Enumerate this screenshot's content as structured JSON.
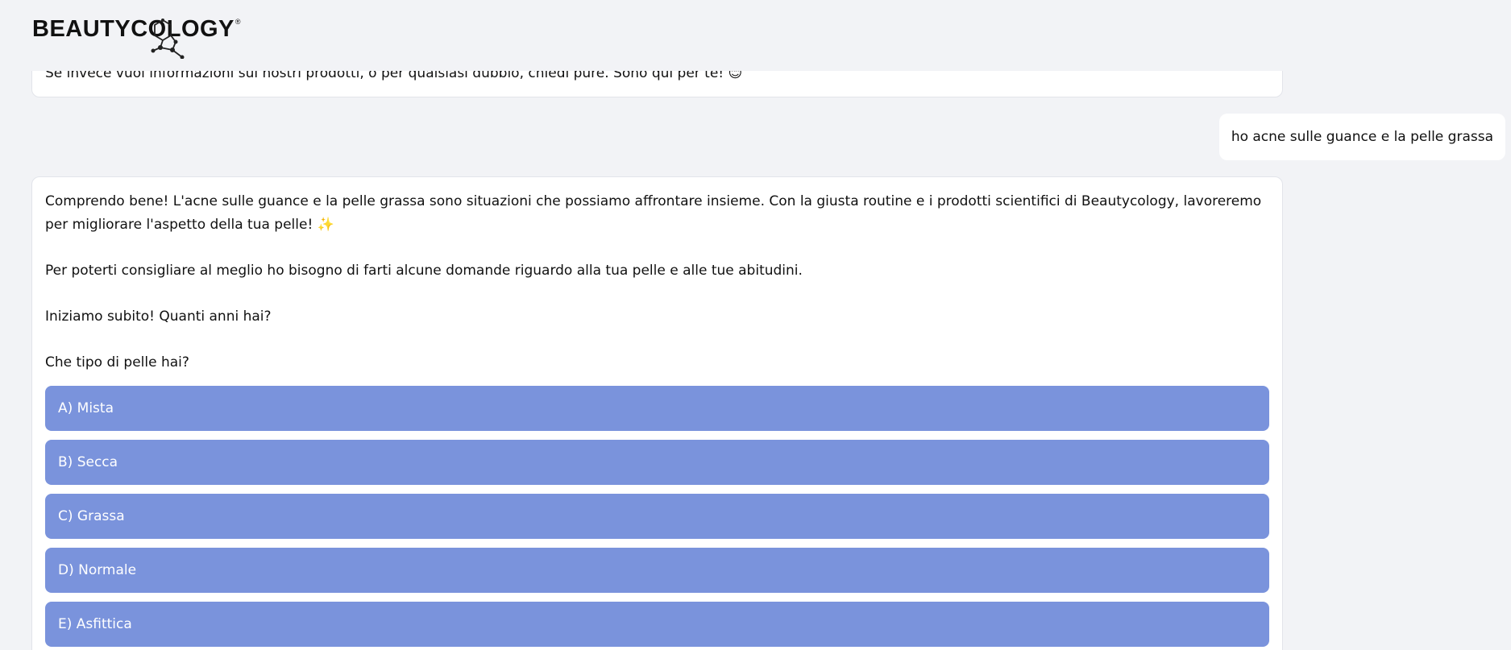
{
  "header": {
    "logo_text": "BEAUTYCOLOGY",
    "logo_reg": "®"
  },
  "chat": {
    "previous_bot_message": "Se invece vuoi informazioni sui nostri prodotti, o per qualsiasi dubbio, chiedi pure. Sono qui per te! 😊",
    "user_message": "ho acne sulle guance e la pelle grassa",
    "bot_message": {
      "paragraph_1": "Comprendo bene! L'acne sulle guance e la pelle grassa sono situazioni che possiamo affrontare insieme. Con la giusta routine e i prodotti scientifici di Beautycology, lavoreremo per migliorare l'aspetto della tua pelle! ✨",
      "paragraph_2": "Per poterti consigliare al meglio ho bisogno di farti alcune domande riguardo alla tua pelle e alle tue abitudini.",
      "paragraph_3": "Iniziamo subito! Quanti anni hai?",
      "paragraph_4": "Che tipo di pelle hai?"
    },
    "options": [
      {
        "label": "A) Mista"
      },
      {
        "label": "B) Secca"
      },
      {
        "label": "C) Grassa"
      },
      {
        "label": "D) Normale"
      },
      {
        "label": "E) Asfittica"
      }
    ]
  },
  "colors": {
    "background": "#f2f3f6",
    "option_button": "#7a93dc",
    "bubble": "#ffffff"
  }
}
